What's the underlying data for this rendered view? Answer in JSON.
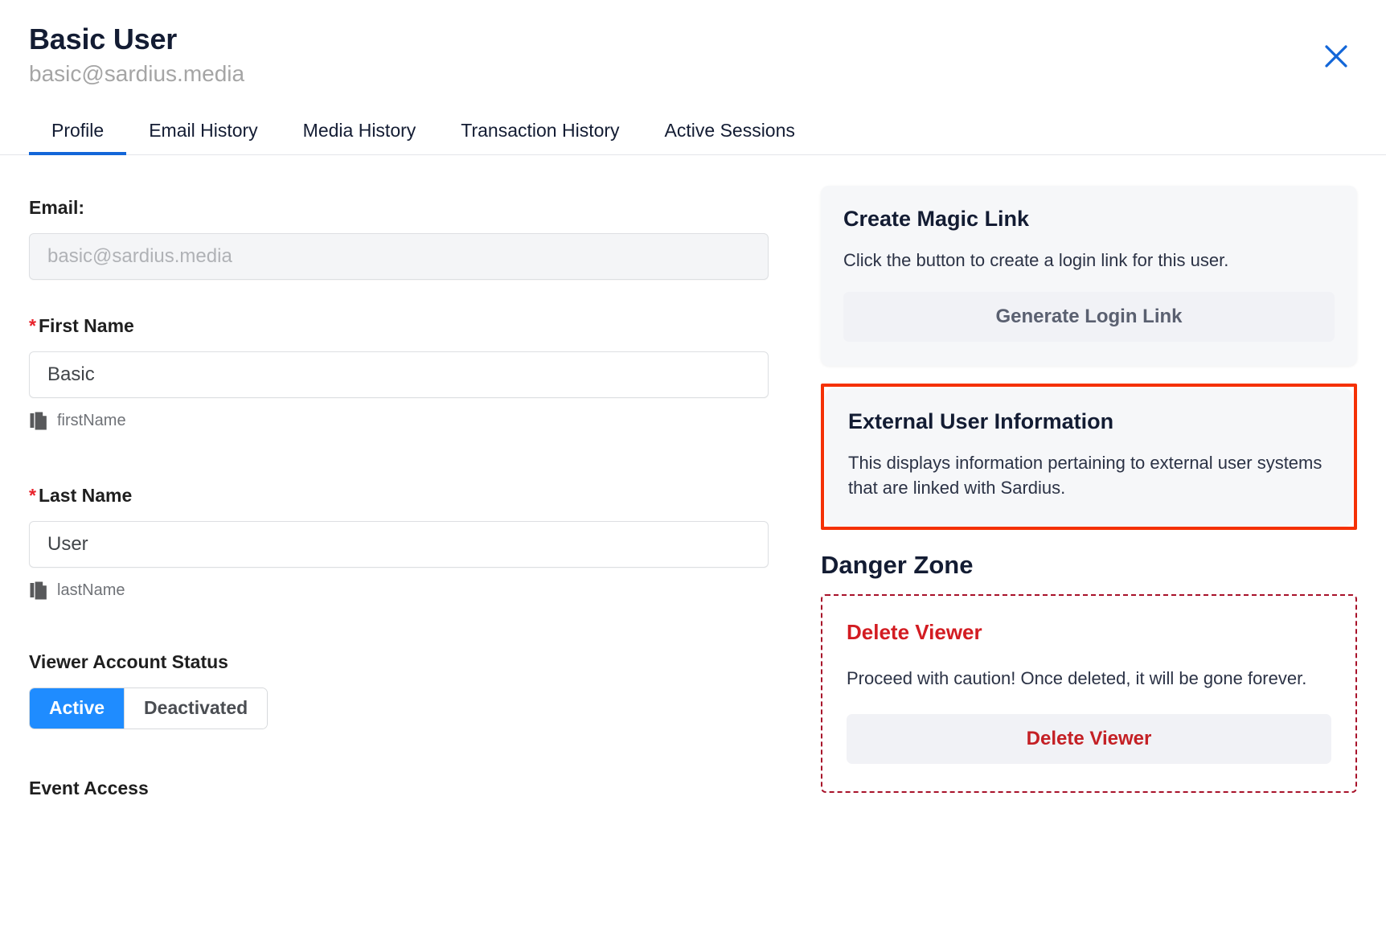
{
  "header": {
    "title": "Basic User",
    "subtitle": "basic@sardius.media",
    "close_icon": "close-icon"
  },
  "tabs": [
    {
      "label": "Profile",
      "active": true
    },
    {
      "label": "Email History",
      "active": false
    },
    {
      "label": "Media History",
      "active": false
    },
    {
      "label": "Transaction History",
      "active": false
    },
    {
      "label": "Active Sessions",
      "active": false
    }
  ],
  "form": {
    "email": {
      "label": "Email:",
      "value": "",
      "placeholder": "basic@sardius.media",
      "disabled": true
    },
    "first_name": {
      "required_marker": "*",
      "label": "First Name",
      "value": "Basic",
      "copy_label": "firstName",
      "copy_icon": "copy-icon"
    },
    "last_name": {
      "required_marker": "*",
      "label": "Last Name",
      "value": "User",
      "copy_label": "lastName",
      "copy_icon": "copy-icon"
    },
    "account_status": {
      "label": "Viewer Account Status",
      "options": [
        "Active",
        "Deactivated"
      ],
      "selected": "Active"
    },
    "event_access_heading": "Event Access"
  },
  "magic_link_card": {
    "title": "Create Magic Link",
    "description": "Click the button to create a login link for this user.",
    "button_label": "Generate Login Link"
  },
  "external_user_card": {
    "title": "External User Information",
    "description": "This displays information pertaining to external user systems that are linked with Sardius.",
    "highlighted": true
  },
  "danger_zone": {
    "heading": "Danger Zone",
    "card_title": "Delete Viewer",
    "description": "Proceed with caution! Once deleted, it will be gone forever.",
    "button_label": "Delete Viewer"
  },
  "colors": {
    "accent_blue": "#1266d8",
    "toggle_blue": "#1f8cff",
    "highlight_red": "#f53105",
    "danger_red": "#d31c22",
    "danger_border": "#a8122a",
    "required_star": "#e8212a",
    "title_navy": "#131c33",
    "muted_gray": "#a5a5a5"
  }
}
